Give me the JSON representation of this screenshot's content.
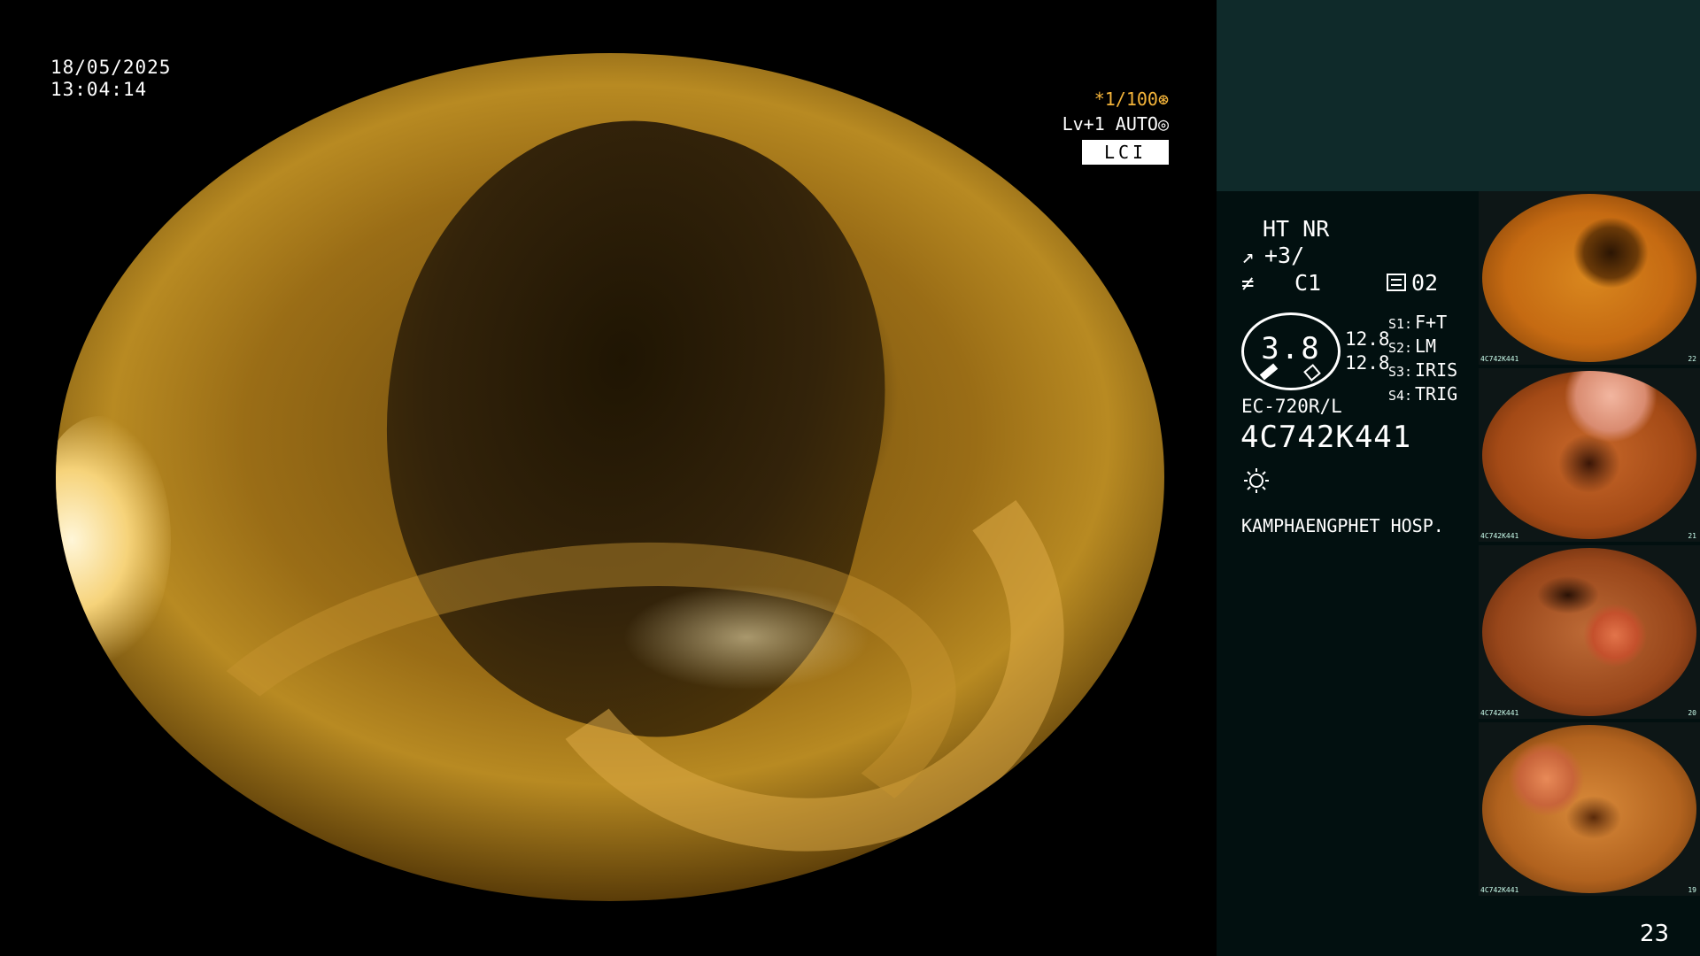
{
  "main_view": {
    "date": "18/05/2025",
    "time": "13:04:14",
    "shutter": "*1/100",
    "level": "Lv+1 AUTO",
    "mode_badge": "LCI"
  },
  "info_panel": {
    "ht_nr": "HT NR",
    "enhancement": "+3/",
    "color": "C1",
    "iris_code": "02",
    "zoom_value": "3.8",
    "measure_a": "12.8",
    "measure_b": "12.8",
    "switches": [
      {
        "key": "S1:",
        "value": "F+T"
      },
      {
        "key": "S2:",
        "value": "LM"
      },
      {
        "key": "S3:",
        "value": "IRIS"
      },
      {
        "key": "S4:",
        "value": "TRIG"
      }
    ],
    "scope_model": "EC-720R/L",
    "scope_serial": "4C742K441",
    "hospital": "KAMPHAENGPHET HOSP."
  },
  "thumbnails": [
    {
      "serial": "4C742K441",
      "index": "22"
    },
    {
      "serial": "4C742K441",
      "index": "21"
    },
    {
      "serial": "4C742K441",
      "index": "20"
    },
    {
      "serial": "4C742K441",
      "index": "19"
    }
  ],
  "page_number": "23",
  "colors": {
    "shutter_accent": "#f4b43a",
    "panel_top": "#0f2a2a",
    "panel_bg": "#021010"
  }
}
